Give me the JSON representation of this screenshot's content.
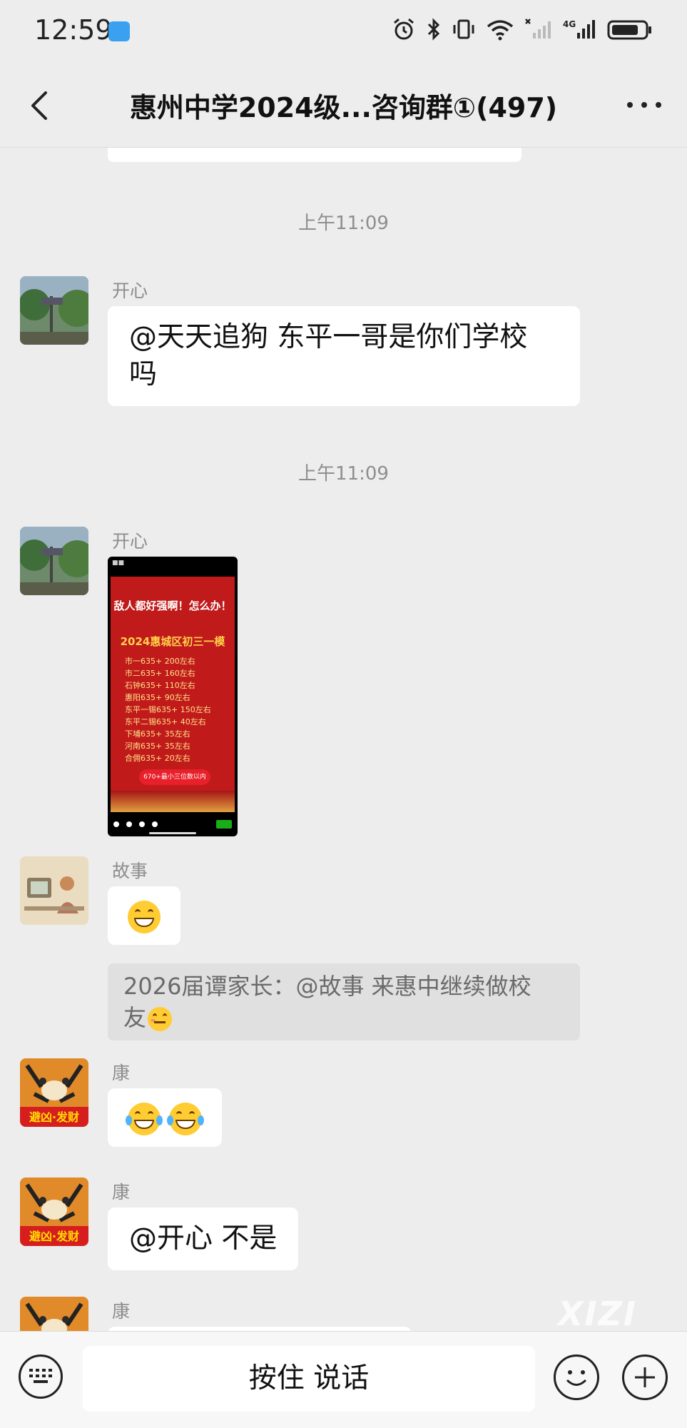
{
  "status_bar": {
    "time": "12:59",
    "network": "4G"
  },
  "title_bar": {
    "title": "惠州中学2024级...咨询群①(497)"
  },
  "messages": [
    {
      "type": "time",
      "text": "上午11:09"
    },
    {
      "type": "text",
      "sender": "开心",
      "text_lines": [
        "@天天追狗  东平一哥是你们学校",
        "吗"
      ]
    },
    {
      "type": "time",
      "text": "上午11:09"
    },
    {
      "type": "image",
      "sender": "开心",
      "image": {
        "headline": "敌人都好强啊！怎么办！",
        "subtitle": "2024惠城区初三一模",
        "rows": [
          "市一635+    200左右",
          "市二635+    160左右",
          "石钟635+    110左右",
          "惠阳635+     90左右",
          "东平一锡635+ 150左右",
          "东平二锡635+  40左右",
          "下埔635+     35左右",
          "河南635+     35左右",
          "合佣635+     20左右"
        ],
        "button": "670+最小三位数以内"
      }
    },
    {
      "type": "emoji",
      "sender": "故事",
      "emoji": "grin",
      "quote": {
        "text_lines": [
          "2026届谭家长：@故事 来惠中继续做校",
          "友"
        ],
        "emoji": "flushed"
      }
    },
    {
      "type": "emoji",
      "sender": "康",
      "emoji": "joy-joy"
    },
    {
      "type": "text",
      "sender": "康",
      "text_lines": [
        "@开心  不是"
      ]
    },
    {
      "type": "partial",
      "sender": "康"
    }
  ],
  "watermark": "XIZI",
  "input_bar": {
    "talk_label": "按住 说话"
  },
  "colors": {
    "background": "#ededed",
    "bubble": "#ffffff",
    "quote_background": "#e0e0e0",
    "poster_red": "#c01a1a"
  }
}
